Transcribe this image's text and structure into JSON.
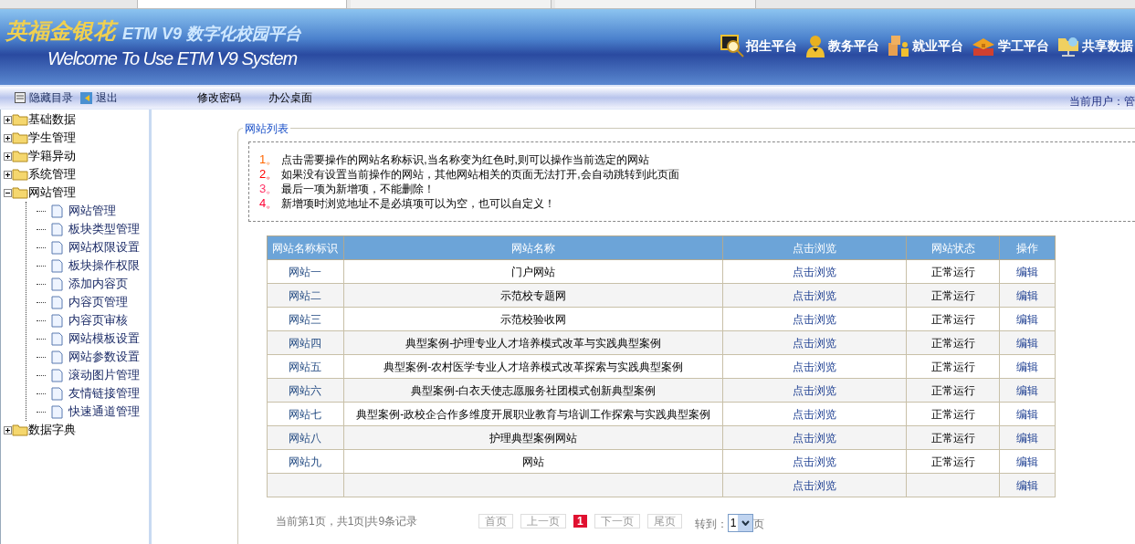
{
  "header": {
    "logo": "英福金银花",
    "product": "ETM V9 数字化校园平台",
    "welcome": "Welcome To Use ETM V9 System",
    "platforms": [
      {
        "label": "招生平台",
        "kind": "monitor"
      },
      {
        "label": "教务平台",
        "kind": "person"
      },
      {
        "label": "就业平台",
        "kind": "boxes"
      },
      {
        "label": "学工平台",
        "kind": "books"
      },
      {
        "label": "共享数据",
        "kind": "folder"
      }
    ]
  },
  "toolbar": {
    "hide_menu": "隐藏目录",
    "logout": "退出",
    "links": [
      "修改密码",
      "办公桌面"
    ],
    "current_user": "当前用户：管"
  },
  "sidebar": {
    "items": [
      {
        "label": "基础数据",
        "expanded": false
      },
      {
        "label": "学生管理",
        "expanded": false
      },
      {
        "label": "学籍异动",
        "expanded": false
      },
      {
        "label": "系统管理",
        "expanded": false
      },
      {
        "label": "网站管理",
        "expanded": true,
        "children": [
          {
            "label": "网站管理"
          },
          {
            "label": "板块类型管理"
          },
          {
            "label": "网站权限设置"
          },
          {
            "label": "板块操作权限"
          },
          {
            "label": "添加内容页"
          },
          {
            "label": "内容页管理"
          },
          {
            "label": "内容页审核"
          },
          {
            "label": "网站模板设置"
          },
          {
            "label": "网站参数设置"
          },
          {
            "label": "滚动图片管理"
          },
          {
            "label": "友情链接管理"
          },
          {
            "label": "快速通道管理"
          }
        ]
      },
      {
        "label": "数据字典",
        "expanded": false
      }
    ]
  },
  "panel": {
    "title": "网站列表",
    "notes": [
      {
        "number": "1。",
        "text": "点击需要操作的网站名称标识,当名称变为红色时,则可以操作当前选定的网站",
        "color": "#ff6600"
      },
      {
        "number": "2。",
        "text": "如果没有设置当前操作的网站，其他网站相关的页面无法打开,会自动跳转到此页面",
        "color": "#ff0000"
      },
      {
        "number": "3。",
        "text": "最后一项为新增项，不能删除！",
        "color": "#ff3366"
      },
      {
        "number": "4。",
        "text": "新增项时浏览地址不是必填项可以为空，也可以自定义！",
        "color": "#ff0033"
      }
    ],
    "table": {
      "columns": [
        "网站名称标识",
        "网站名称",
        "点击浏览",
        "网站状态",
        "操作"
      ],
      "rows": [
        [
          "网站一",
          "门户网站",
          "点击浏览",
          "正常运行",
          "编辑"
        ],
        [
          "网站二",
          "示范校专题网",
          "点击浏览",
          "正常运行",
          "编辑"
        ],
        [
          "网站三",
          "示范校验收网",
          "点击浏览",
          "正常运行",
          "编辑"
        ],
        [
          "网站四",
          "典型案例-护理专业人才培养模式改革与实践典型案例",
          "点击浏览",
          "正常运行",
          "编辑"
        ],
        [
          "网站五",
          "典型案例-农村医学专业人才培养模式改革探索与实践典型案例",
          "点击浏览",
          "正常运行",
          "编辑"
        ],
        [
          "网站六",
          "典型案例-白衣天使志愿服务社团模式创新典型案例",
          "点击浏览",
          "正常运行",
          "编辑"
        ],
        [
          "网站七",
          "典型案例-政校企合作多维度开展职业教育与培训工作探索与实践典型案例",
          "点击浏览",
          "正常运行",
          "编辑"
        ],
        [
          "网站八",
          "护理典型案例网站",
          "点击浏览",
          "正常运行",
          "编辑"
        ],
        [
          "网站九",
          "网站",
          "点击浏览",
          "正常运行",
          "编辑"
        ],
        [
          "",
          "",
          "点击浏览",
          "",
          "编辑"
        ]
      ]
    },
    "pagination": {
      "summary": "当前第1页，共1页|共9条记录",
      "first": "首页",
      "prev": "上一页",
      "current": "1",
      "next": "下一页",
      "last": "尾页",
      "goto": "转到：",
      "page_value": "1",
      "page_unit": "页"
    }
  }
}
